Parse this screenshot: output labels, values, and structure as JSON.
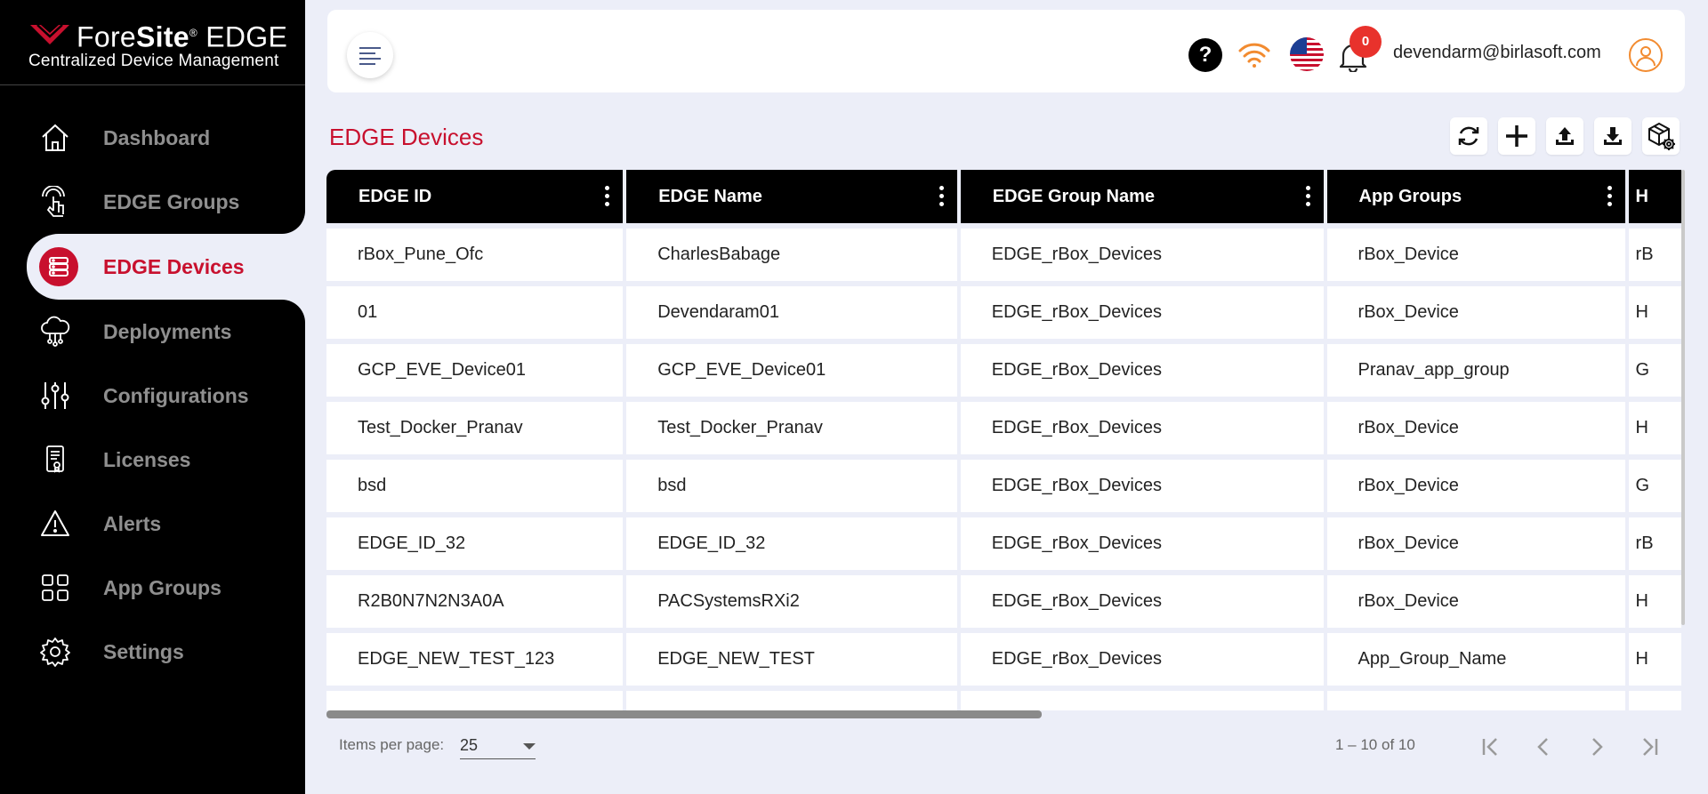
{
  "brand": {
    "fore": "Fore",
    "site": "Site",
    "registered": "®",
    "edge": " EDGE",
    "subtitle": "Centralized Device Management"
  },
  "sidebar": {
    "items": [
      {
        "label": "Dashboard",
        "icon": "home-icon"
      },
      {
        "label": "EDGE Groups",
        "icon": "touch-icon"
      },
      {
        "label": "EDGE Devices",
        "icon": "server-icon",
        "active": true
      },
      {
        "label": "Deployments",
        "icon": "cloud-network-icon"
      },
      {
        "label": "Configurations",
        "icon": "sliders-icon"
      },
      {
        "label": "Licenses",
        "icon": "license-icon"
      },
      {
        "label": "Alerts",
        "icon": "warning-icon"
      },
      {
        "label": "App Groups",
        "icon": "grid-icon"
      },
      {
        "label": "Settings",
        "icon": "gear-icon"
      }
    ]
  },
  "header": {
    "help": "?",
    "notification_count": "0",
    "user_email": "devendarm@birlasoft.com"
  },
  "page": {
    "title": "EDGE Devices"
  },
  "table": {
    "columns": [
      "EDGE ID",
      "EDGE Name",
      "EDGE Group Name",
      "App Groups",
      "H"
    ],
    "rows": [
      [
        "rBox_Pune_Ofc",
        "CharlesBabage",
        "EDGE_rBox_Devices",
        "rBox_Device",
        "rB"
      ],
      [
        "01",
        "Devendaram01",
        "EDGE_rBox_Devices",
        "rBox_Device",
        "H"
      ],
      [
        "GCP_EVE_Device01",
        "GCP_EVE_Device01",
        "EDGE_rBox_Devices",
        "Pranav_app_group",
        "G"
      ],
      [
        "Test_Docker_Pranav",
        "Test_Docker_Pranav",
        "EDGE_rBox_Devices",
        "rBox_Device",
        "H"
      ],
      [
        "bsd",
        "bsd",
        "EDGE_rBox_Devices",
        "rBox_Device",
        "G"
      ],
      [
        "EDGE_ID_32",
        "EDGE_ID_32",
        "EDGE_rBox_Devices",
        "rBox_Device",
        "rB"
      ],
      [
        "R2B0N7N2N3A0A",
        "PACSystemsRXi2",
        "EDGE_rBox_Devices",
        "rBox_Device",
        "H"
      ],
      [
        "EDGE_NEW_TEST_123",
        "EDGE_NEW_TEST",
        "EDGE_rBox_Devices",
        "App_Group_Name",
        "H"
      ]
    ]
  },
  "paginator": {
    "items_per_page_label": "Items per page:",
    "items_per_page_value": "25",
    "range_label": "1 – 10 of 10"
  },
  "colors": {
    "accent": "#c8102e",
    "sidebar_bg": "#000000",
    "page_bg": "#eceef8"
  }
}
